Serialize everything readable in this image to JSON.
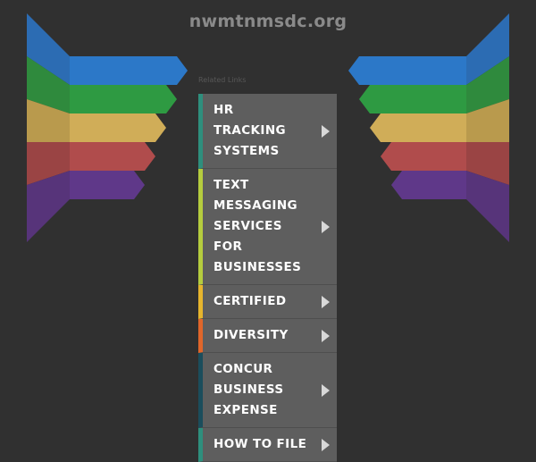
{
  "page": {
    "domain_title": "nwmtnmsdc.org",
    "related_label": "Related Links"
  },
  "links": [
    {
      "label": "HR TRACKING SYSTEMS",
      "accent": "#2e8f7d",
      "icon": "arrow-right-icon"
    },
    {
      "label": "TEXT MESSAGING SERVICES FOR BUSINESSES",
      "accent": "#b5cc3e",
      "icon": "arrow-right-icon"
    },
    {
      "label": "CERTIFIED",
      "accent": "#e6b52d",
      "icon": "arrow-right-icon"
    },
    {
      "label": "DIVERSITY",
      "accent": "#e0662a",
      "icon": "arrow-right-icon"
    },
    {
      "label": "CONCUR BUSINESS EXPENSE",
      "accent": "#1b4d5c",
      "icon": "arrow-right-icon"
    },
    {
      "label": "HOW TO FILE",
      "accent": "#2e8f7d",
      "icon": "arrow-right-icon"
    }
  ],
  "theme": {
    "background": "#303030",
    "button_bg": "#5e5e5e",
    "ribbon_colors": [
      "#2f6fb5",
      "#2e8b3e",
      "#c9a84f",
      "#a84a4a",
      "#5a3480"
    ]
  }
}
